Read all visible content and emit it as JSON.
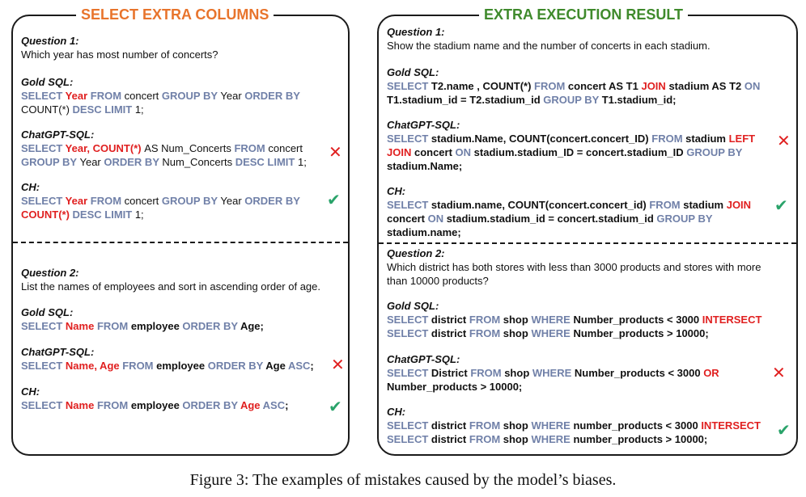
{
  "left": {
    "title": "SELECT EXTRA COLUMNS",
    "q1": {
      "label": "Question 1:",
      "text": "Which year has most number of concerts?",
      "gold_label": "Gold SQL:",
      "chatgpt_label": "ChatGPT-SQL:",
      "ch_label": "CH:"
    },
    "q2": {
      "label": "Question 2:",
      "text": "List the names of employees and sort in ascending order of age.",
      "gold_label": "Gold SQL:",
      "chatgpt_label": "ChatGPT-SQL:",
      "ch_label": "CH:"
    }
  },
  "right": {
    "title": "EXTRA EXECUTION RESULT",
    "q1": {
      "label": "Question 1:",
      "text": "Show the stadium name and the number of concerts in each stadium.",
      "gold_label": "Gold SQL:",
      "chatgpt_label": "ChatGPT-SQL:",
      "ch_label": "CH:"
    },
    "q2": {
      "label": "Question 2:",
      "text1": "Which district has both stores with less than 3000 products and stores with more",
      "text2": "than 10000 products?",
      "gold_label": "Gold SQL:",
      "chatgpt_label": "ChatGPT-SQL:",
      "ch_label": "CH:"
    }
  },
  "marks": {
    "wrong": "✕",
    "right": "✔"
  },
  "colors": {
    "keyword": "#7080a8",
    "highlight": "#e02020",
    "left_title": "#e8742c",
    "right_title": "#3f8a2c",
    "check": "#2aa36a"
  },
  "caption": "Figure 3: The examples of mistakes caused by the model’s biases.",
  "sql": {
    "l1_gold_1": [
      [
        "kw",
        "SELECT "
      ],
      [
        "hl",
        "Year "
      ],
      [
        "kw",
        "FROM "
      ],
      [
        "tx",
        "concert "
      ],
      [
        "kw",
        "GROUP BY "
      ],
      [
        "tx",
        "Year "
      ],
      [
        "kw",
        "ORDER BY"
      ]
    ],
    "l1_gold_2": [
      [
        "tx",
        "COUNT(*) "
      ],
      [
        "kw",
        "DESC LIMIT "
      ],
      [
        "tx",
        "1;"
      ]
    ],
    "l1_gpt_1": [
      [
        "kw",
        "SELECT "
      ],
      [
        "hl",
        "Year, COUNT(*) "
      ],
      [
        "tx",
        "AS Num_Concerts "
      ],
      [
        "kw",
        "FROM "
      ],
      [
        "tx",
        "concert"
      ]
    ],
    "l1_gpt_2": [
      [
        "kw",
        "GROUP BY "
      ],
      [
        "tx",
        "Year "
      ],
      [
        "kw",
        "ORDER BY "
      ],
      [
        "tx",
        "Num_Concerts "
      ],
      [
        "kw",
        "DESC LIMIT "
      ],
      [
        "tx",
        "1;"
      ]
    ],
    "l1_ch_1": [
      [
        "kw",
        "SELECT "
      ],
      [
        "hl",
        "Year "
      ],
      [
        "kw",
        "FROM "
      ],
      [
        "tx",
        "concert "
      ],
      [
        "kw",
        "GROUP BY "
      ],
      [
        "tx",
        "Year "
      ],
      [
        "kw",
        "ORDER BY"
      ]
    ],
    "l1_ch_2": [
      [
        "hl",
        "COUNT(*) "
      ],
      [
        "kw",
        "DESC LIMIT "
      ],
      [
        "tx",
        "1;"
      ]
    ],
    "l2_gold_1": [
      [
        "kw",
        "SELECT "
      ],
      [
        "hl",
        "Name "
      ],
      [
        "kw",
        "FROM "
      ],
      [
        "tx",
        "employee "
      ],
      [
        "kw",
        "ORDER BY "
      ],
      [
        "tx",
        "Age;"
      ]
    ],
    "l2_gpt_1": [
      [
        "kw",
        "SELECT "
      ],
      [
        "hl",
        "Name, Age "
      ],
      [
        "kw",
        "FROM "
      ],
      [
        "tx",
        "employee "
      ],
      [
        "kw",
        "ORDER BY "
      ],
      [
        "tx",
        "Age "
      ],
      [
        "kw",
        "ASC"
      ],
      [
        "tx",
        ";"
      ]
    ],
    "l2_ch_1": [
      [
        "kw",
        "SELECT "
      ],
      [
        "hl",
        "Name "
      ],
      [
        "kw",
        "FROM "
      ],
      [
        "tx",
        "employee "
      ],
      [
        "kw",
        "ORDER BY "
      ],
      [
        "hl",
        "Age "
      ],
      [
        "kw",
        "ASC"
      ],
      [
        "tx",
        ";"
      ]
    ],
    "r1_gold_1": [
      [
        "kw",
        "SELECT "
      ],
      [
        "tx",
        "T2.name ,  COUNT(*) "
      ],
      [
        "kw",
        "FROM "
      ],
      [
        "tx",
        "concert AS T1 "
      ],
      [
        "hl",
        "JOIN "
      ],
      [
        "tx",
        "stadium AS T2 "
      ],
      [
        "kw",
        "ON"
      ]
    ],
    "r1_gold_2": [
      [
        "tx",
        "T1.stadium_id  =  T2.stadium_id "
      ],
      [
        "kw",
        "GROUP BY "
      ],
      [
        "tx",
        "T1.stadium_id;"
      ]
    ],
    "r1_gpt_1": [
      [
        "kw",
        "SELECT "
      ],
      [
        "tx",
        "stadium.Name, COUNT(concert.concert_ID) "
      ],
      [
        "kw",
        "FROM "
      ],
      [
        "tx",
        "stadium "
      ],
      [
        "hl",
        "LEFT"
      ]
    ],
    "r1_gpt_2": [
      [
        "hl",
        "JOIN "
      ],
      [
        "tx",
        "concert "
      ],
      [
        "kw",
        "ON "
      ],
      [
        "tx",
        "stadium.stadium_ID = concert.stadium_ID "
      ],
      [
        "kw",
        "GROUP BY"
      ]
    ],
    "r1_gpt_3": [
      [
        "tx",
        "stadium.Name;"
      ]
    ],
    "r1_ch_1": [
      [
        "kw",
        "SELECT "
      ],
      [
        "tx",
        "stadium.name, COUNT(concert.concert_id) "
      ],
      [
        "kw",
        "FROM "
      ],
      [
        "tx",
        "stadium "
      ],
      [
        "hl",
        "JOIN"
      ]
    ],
    "r1_ch_2": [
      [
        "tx",
        "concert "
      ],
      [
        "kw",
        "ON "
      ],
      [
        "tx",
        "stadium.stadium_id = concert.stadium_id "
      ],
      [
        "kw",
        "GROUP BY"
      ]
    ],
    "r1_ch_3": [
      [
        "tx",
        "stadium.name;"
      ]
    ],
    "r2_gold_1": [
      [
        "kw",
        "SELECT "
      ],
      [
        "tx",
        "district "
      ],
      [
        "kw",
        "FROM "
      ],
      [
        "tx",
        "shop "
      ],
      [
        "kw",
        "WHERE "
      ],
      [
        "tx",
        "Number_products < 3000 "
      ],
      [
        "hl",
        "INTERSECT"
      ]
    ],
    "r2_gold_2": [
      [
        "kw",
        "SELECT "
      ],
      [
        "tx",
        "district "
      ],
      [
        "kw",
        "FROM "
      ],
      [
        "tx",
        "shop "
      ],
      [
        "kw",
        "WHERE "
      ],
      [
        "tx",
        "Number_products > 10000;"
      ]
    ],
    "r2_gpt_1": [
      [
        "kw",
        "SELECT "
      ],
      [
        "tx",
        "District "
      ],
      [
        "kw",
        "FROM "
      ],
      [
        "tx",
        "shop "
      ],
      [
        "kw",
        "WHERE "
      ],
      [
        "tx",
        "Number_products < 3000 "
      ],
      [
        "hl",
        "OR"
      ]
    ],
    "r2_gpt_2": [
      [
        "tx",
        "Number_products > 10000;"
      ]
    ],
    "r2_ch_1": [
      [
        "kw",
        "SELECT "
      ],
      [
        "tx",
        "district "
      ],
      [
        "kw",
        "FROM "
      ],
      [
        "tx",
        "shop "
      ],
      [
        "kw",
        "WHERE "
      ],
      [
        "tx",
        "number_products < 3000 "
      ],
      [
        "hl",
        "INTERSECT"
      ]
    ],
    "r2_ch_2": [
      [
        "kw",
        "SELECT "
      ],
      [
        "tx",
        "district "
      ],
      [
        "kw",
        "FROM "
      ],
      [
        "tx",
        "shop "
      ],
      [
        "kw",
        "WHERE "
      ],
      [
        "tx",
        "number_products > 10000;"
      ]
    ]
  }
}
